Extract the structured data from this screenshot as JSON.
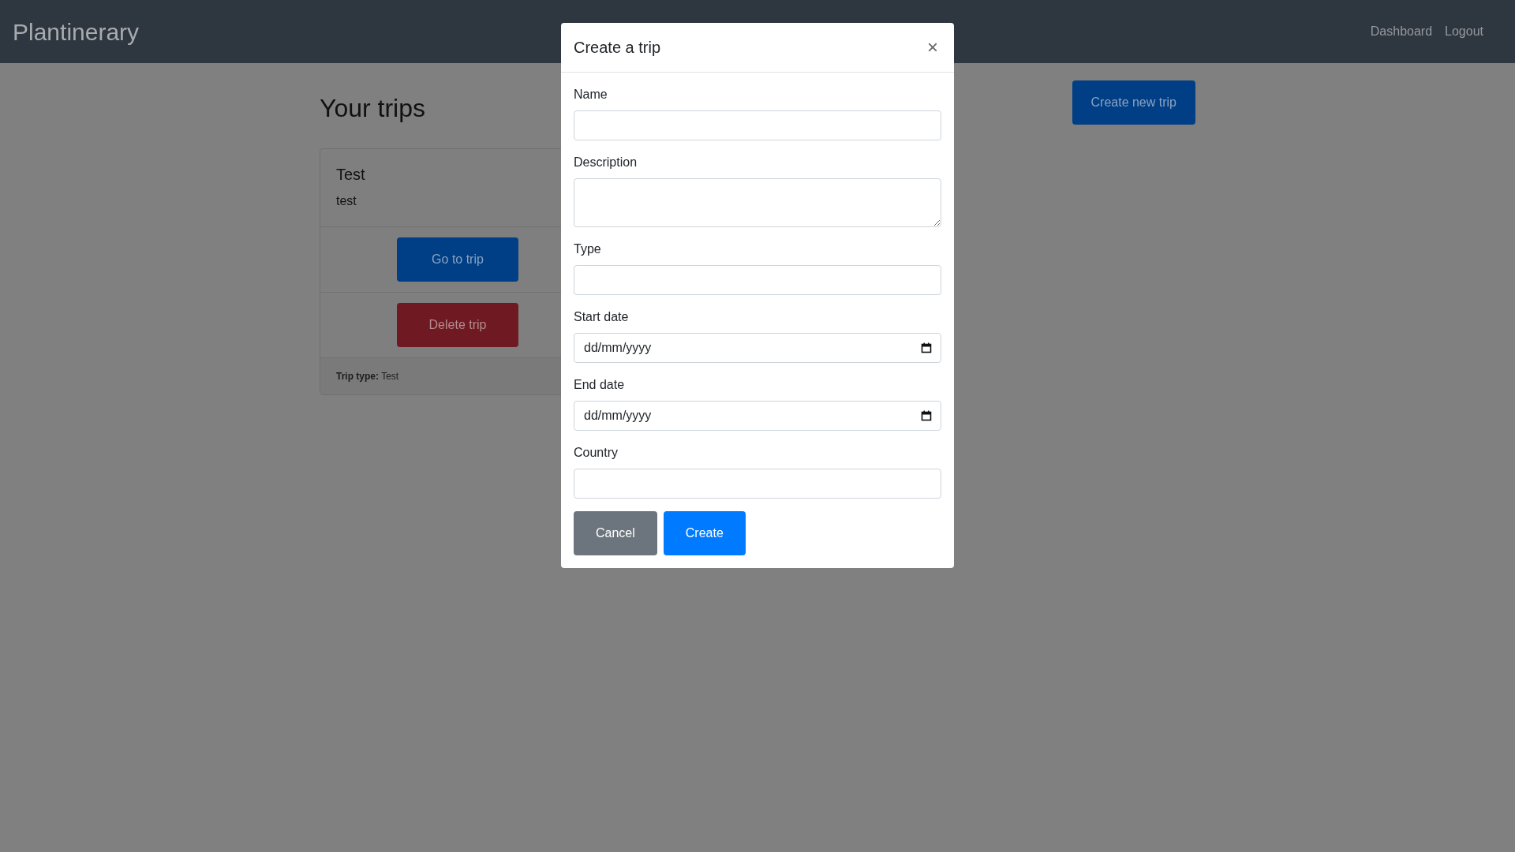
{
  "navbar": {
    "brand": "Plantinerary",
    "links": [
      "Dashboard",
      "Logout"
    ]
  },
  "page": {
    "heading": "Your trips",
    "create_button": "Create new trip"
  },
  "trips": [
    {
      "title": "Test",
      "description": "test",
      "actions": [
        {
          "label": "Go to trip",
          "kind": "primary"
        },
        {
          "label": "Delete trip",
          "kind": "danger"
        }
      ],
      "footer": "**Trip type:** Test"
    }
  ],
  "modal": {
    "title": "Create a trip",
    "close": "×",
    "fields": [
      {
        "label": "Name",
        "kind": "text"
      },
      {
        "label": "Description",
        "kind": "textarea"
      },
      {
        "label": "Type",
        "kind": "text"
      },
      {
        "label": "Start date",
        "kind": "date",
        "placeholder": "dd/mm/yyyy"
      },
      {
        "label": "End date",
        "kind": "date",
        "placeholder": "dd/mm/yyyy"
      },
      {
        "label": "Country",
        "kind": "text"
      }
    ],
    "buttons": [
      {
        "label": "Cancel",
        "kind": "secondary"
      },
      {
        "label": "Create",
        "kind": "primary"
      }
    ]
  }
}
